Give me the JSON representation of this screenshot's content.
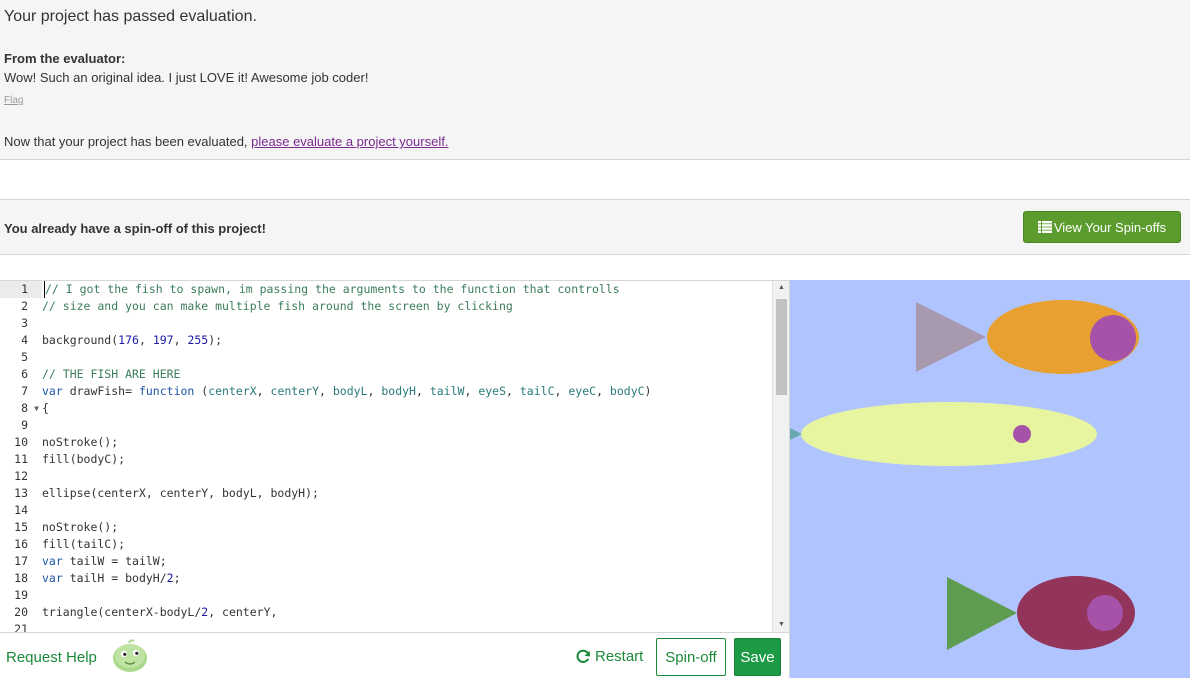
{
  "evaluation": {
    "title": "Your project has passed evaluation.",
    "from_label": "From the evaluator:",
    "message": "Wow! Such an original idea. I just LOVE it! Awesome job coder!",
    "flag_label": "Flag",
    "next_prefix": "Now that your project has been evaluated, ",
    "next_link": "please evaluate a project yourself."
  },
  "spinoff": {
    "text": "You already have a spin-off of this project!",
    "button_label": "View Your Spin-offs",
    "button_icon": "list-icon"
  },
  "editor": {
    "line_numbers": [
      "1",
      "2",
      "3",
      "4",
      "5",
      "6",
      "7",
      "8",
      "9",
      "10",
      "11",
      "12",
      "13",
      "14",
      "15",
      "16",
      "17",
      "18",
      "19",
      "20",
      "21"
    ],
    "lines": [
      "// I got the fish to spawn, im passing the arguments to the function that controlls",
      "// size and you can make multiple fish around the screen by clicking",
      "",
      "background(176, 197, 255);",
      "",
      "// THE FISH ARE HERE",
      "var drawFish= function (centerX, centerY, bodyL, bodyH, tailW, eyeS, tailC, eyeC, bodyC)",
      "{",
      "",
      "noStroke();",
      "fill(bodyC);",
      "",
      "ellipse(centerX, centerY, bodyL, bodyH);",
      "",
      "noStroke();",
      "fill(tailC);",
      "var tailW = tailW;",
      "var tailH = bodyH/2;",
      "",
      "triangle(centerX-bodyL/2, centerY,",
      ""
    ]
  },
  "canvas": {
    "background": "#b0c5ff",
    "fish": [
      {
        "body": "#e8a030",
        "tail": "#a89aae",
        "eye": "#a552a8"
      },
      {
        "body": "#e8f5a0",
        "tail": "#6aa8b0",
        "eye": "#a552a8"
      },
      {
        "body": "#93345a",
        "tail": "#5e9c52",
        "eye": "#a552a8"
      }
    ]
  },
  "bottom": {
    "request_help": "Request Help",
    "restart_label": "Restart",
    "spinoff_label": "Spin-off",
    "save_label": "Save"
  }
}
